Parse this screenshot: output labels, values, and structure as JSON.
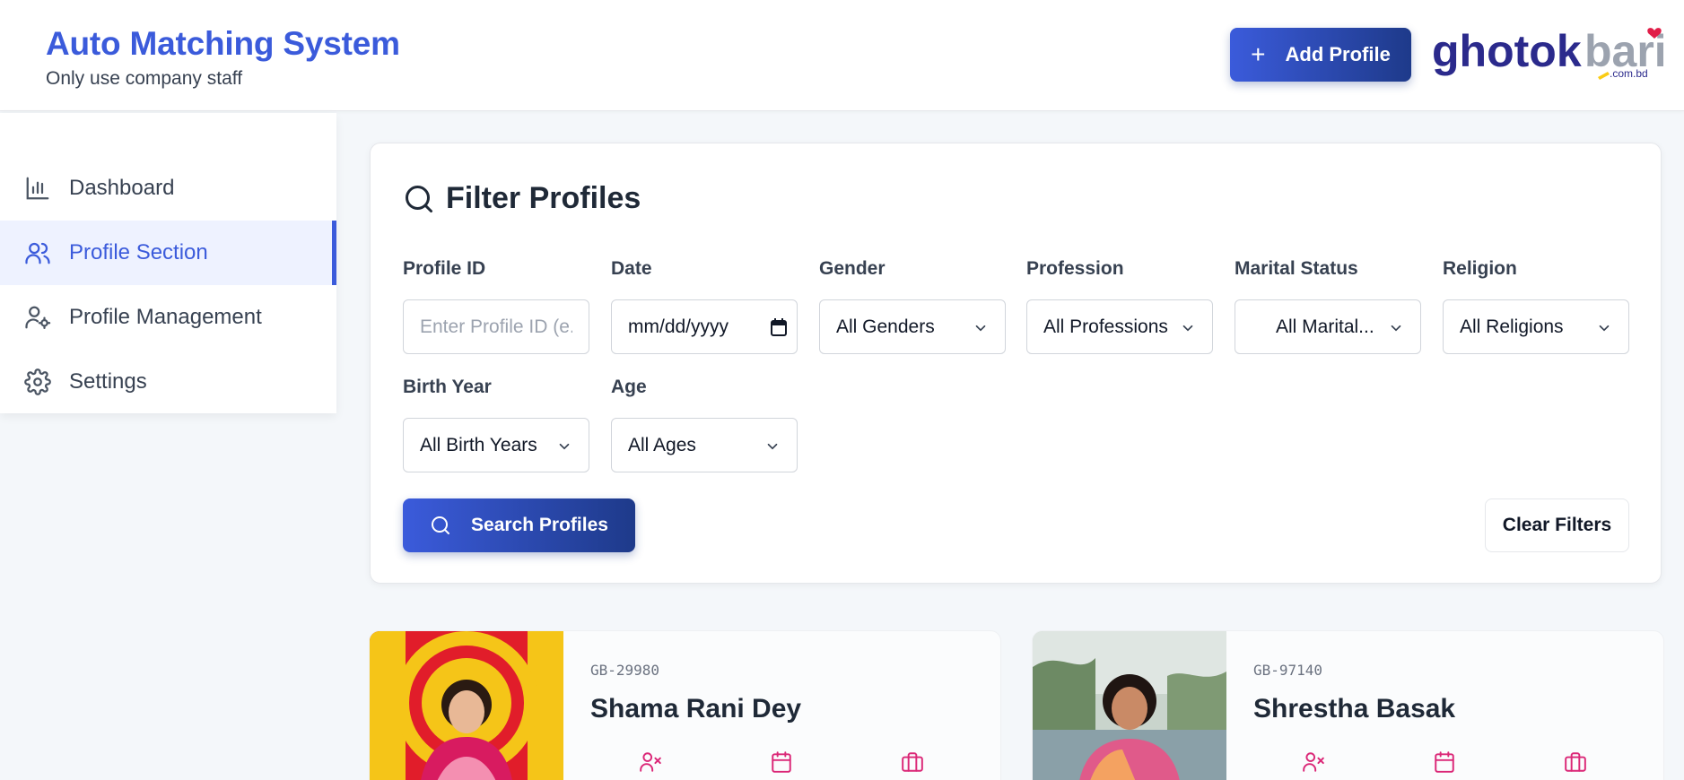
{
  "header": {
    "title": "Auto Matching System",
    "subtitle": "Only use company staff",
    "add_profile_label": "Add Profile",
    "logo_text": "ghotokbari",
    "logo_suffix": ".com.bd"
  },
  "sidebar": {
    "items": [
      {
        "label": "Dashboard",
        "icon": "bar-chart-icon",
        "active": false
      },
      {
        "label": "Profile Section",
        "icon": "users-icon",
        "active": true
      },
      {
        "label": "Profile Management",
        "icon": "user-cog-icon",
        "active": false
      },
      {
        "label": "Settings",
        "icon": "gear-icon",
        "active": false
      }
    ]
  },
  "filter": {
    "title": "Filter Profiles",
    "fields": {
      "profile_id": {
        "label": "Profile ID",
        "placeholder": "Enter Profile ID (e.g",
        "value": ""
      },
      "date": {
        "label": "Date",
        "value": "mm/dd/yyyy"
      },
      "gender": {
        "label": "Gender",
        "value": "All Genders"
      },
      "profession": {
        "label": "Profession",
        "value": "All Professions"
      },
      "marital_status": {
        "label": "Marital Status",
        "value": "All Marital..."
      },
      "religion": {
        "label": "Religion",
        "value": "All Religions"
      },
      "birth_year": {
        "label": "Birth Year",
        "value": "All Birth Years"
      },
      "age": {
        "label": "Age",
        "value": "All Ages"
      }
    },
    "search_label": "Search Profiles",
    "clear_label": "Clear Filters"
  },
  "profiles": [
    {
      "id": "GB-29980",
      "name": "Shama Rani Dey"
    },
    {
      "id": "GB-97140",
      "name": "Shrestha Basak"
    }
  ],
  "colors": {
    "accent": "#3b5bdb",
    "accent_dark": "#1e3a8a",
    "meta_icon": "#db2777",
    "logo_primary": "#2b2a8c",
    "logo_secondary": "#9ca3af",
    "heart": "#e11d48"
  }
}
